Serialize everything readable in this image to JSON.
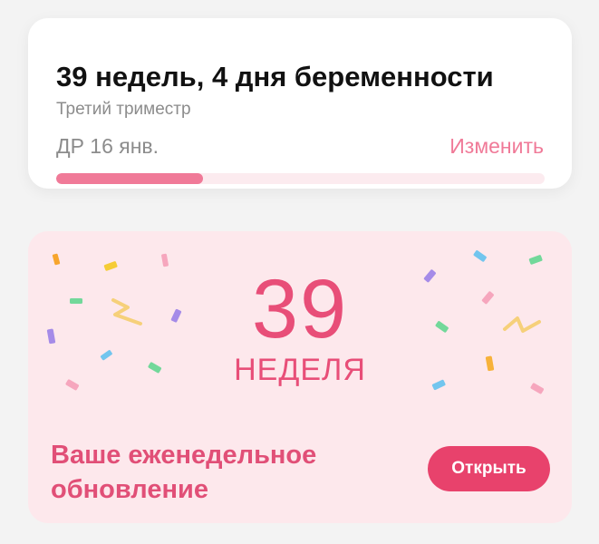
{
  "pregnancy_card": {
    "title": "39 недель, 4 дня беременности",
    "trimester": "Третий триместр",
    "due_date": "ДР 16 янв.",
    "change_label": "Изменить",
    "progress_fraction": 0.3,
    "accent_color": "#f07a98"
  },
  "weekly_card": {
    "week_number": "39",
    "week_label": "НЕДЕЛЯ",
    "update_text": "Ваше еженедельное обновление",
    "open_label": "Открыть",
    "background_color": "#fde8ec",
    "button_color": "#e8426c"
  }
}
